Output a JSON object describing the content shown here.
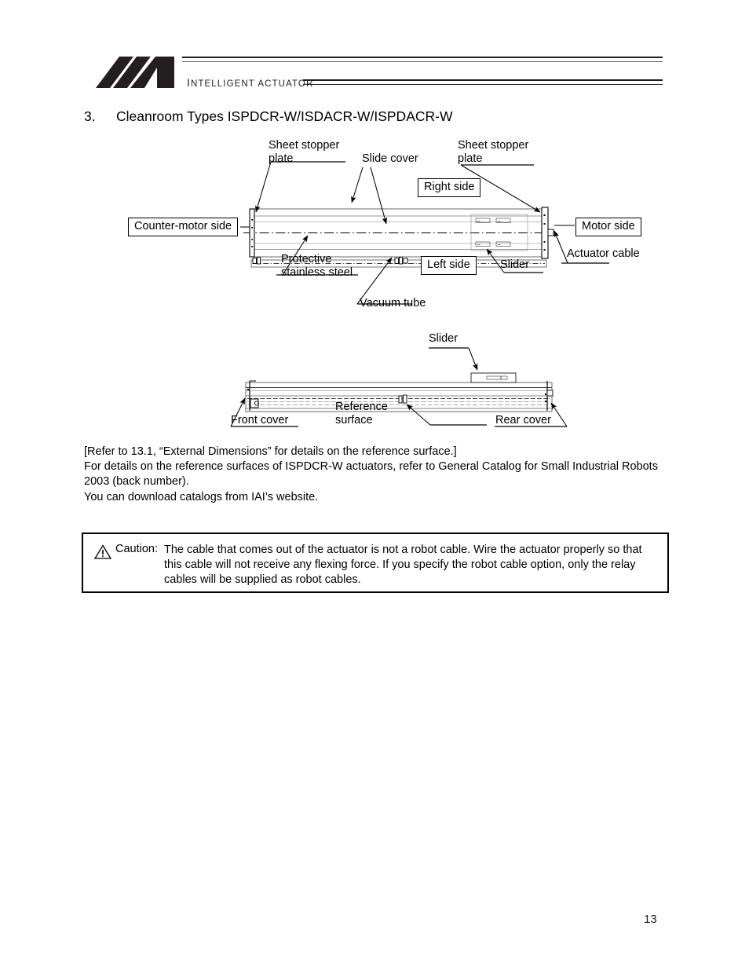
{
  "header": {
    "logo_icon": "ia-logo-icon",
    "wordmark_first_letter": "I",
    "wordmark_rest": "NTELLIGENT ACTUATOR",
    "wordmark_full": "INTELLIGENT ACTUATOR"
  },
  "section": {
    "number": "3.",
    "title": "Cleanroom Types ISPDCR-W/ISDACR-W/ISPDACR-W"
  },
  "diagram_top": {
    "name": "cleanroom-actuator-top-view",
    "labels": {
      "sheet_stopper_plate_left": "Sheet stopper\nplate",
      "sheet_stopper_plate_left_l1": "Sheet stopper",
      "sheet_stopper_plate_left_l2": "plate",
      "slide_cover": "Slide cover",
      "sheet_stopper_plate_right_l1": "Sheet stopper",
      "sheet_stopper_plate_right_l2": "plate",
      "right_side": "Right side",
      "counter_motor_side": "Counter-motor side",
      "motor_side": "Motor side",
      "actuator_cable": "Actuator cable",
      "protective_stainless_steel_l1": "Protective",
      "protective_stainless_steel_l2": "stainless steel",
      "left_side": "Left side",
      "slider": "Slider",
      "vacuum_tube": "Vacuum tube"
    }
  },
  "diagram_bottom": {
    "name": "cleanroom-actuator-side-view",
    "labels": {
      "slider": "Slider",
      "front_cover": "Front cover",
      "reference_surface_l1": "Reference",
      "reference_surface_l2": "surface",
      "rear_cover": "Rear cover"
    }
  },
  "body": {
    "line1": "[Refer to 13.1, “External Dimensions” for details on the reference surface.]",
    "line2": "For details on the reference surfaces of ISPDCR-W actuators, refer to General Catalog for Small Industrial Robots 2003 (back number).",
    "line3": "You can download catalogs from IAI’s website."
  },
  "caution": {
    "icon": "warning-triangle-icon",
    "label": "Caution:",
    "text": "The cable that comes out of the actuator is not a robot cable. Wire the actuator properly so that this cable will not receive any flexing force. If you specify the robot cable option, only the relay cables will be supplied as robot cables."
  },
  "footer": {
    "page_number": "13"
  },
  "colors": {
    "ink": "#000000",
    "logo": "#231f20",
    "rule_gray": "#6d6a66"
  }
}
